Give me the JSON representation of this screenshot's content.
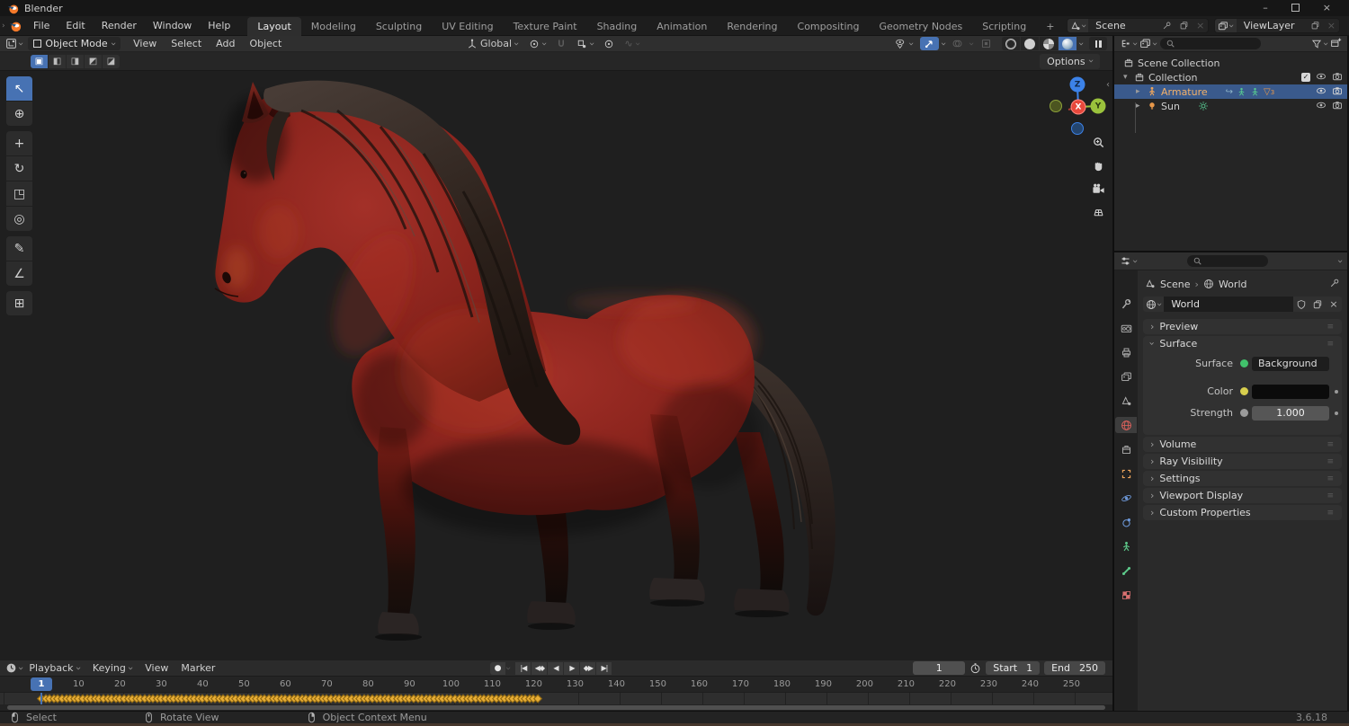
{
  "window": {
    "title": "Blender"
  },
  "topbar": {
    "menus": [
      "File",
      "Edit",
      "Render",
      "Window",
      "Help"
    ],
    "workspaces": [
      "Layout",
      "Modeling",
      "Sculpting",
      "UV Editing",
      "Texture Paint",
      "Shading",
      "Animation",
      "Rendering",
      "Compositing",
      "Geometry Nodes",
      "Scripting",
      "+"
    ],
    "active_workspace": "Layout",
    "scene": {
      "label": "Scene"
    },
    "viewlayer": {
      "label": "ViewLayer"
    }
  },
  "viewport": {
    "mode": "Object Mode",
    "menus": [
      "View",
      "Select",
      "Add",
      "Object"
    ],
    "orientation": "Global",
    "options_label": "Options",
    "tools": [
      {
        "name": "select-box",
        "glyph": "↖"
      },
      {
        "name": "cursor",
        "glyph": "⊕"
      },
      {
        "name": "move",
        "glyph": "+"
      },
      {
        "name": "rotate",
        "glyph": "↻"
      },
      {
        "name": "scale",
        "glyph": "◳"
      },
      {
        "name": "transform",
        "glyph": "◎"
      },
      {
        "name": "annotate",
        "glyph": "✎"
      },
      {
        "name": "measure",
        "glyph": "∠"
      },
      {
        "name": "add-cube",
        "glyph": "⊞"
      }
    ],
    "select_modes": [
      "▣",
      "◧",
      "◨",
      "◩",
      "◪"
    ],
    "gizmo_axes": {
      "x": "X",
      "y": "Y",
      "z": "Z"
    }
  },
  "outliner": {
    "rows": [
      {
        "label": "Scene Collection"
      },
      {
        "label": "Collection"
      },
      {
        "label": "Armature",
        "badge": "3"
      },
      {
        "label": "Sun"
      }
    ]
  },
  "properties": {
    "breadcrumb": {
      "scene": "Scene",
      "sep": "›",
      "world": "World"
    },
    "datablock_name": "World",
    "panels": {
      "preview": "Preview",
      "surface": {
        "title": "Surface",
        "surface_label": "Surface",
        "surface_value": "Background",
        "color_label": "Color",
        "strength_label": "Strength",
        "strength_value": "1.000"
      },
      "collapsed": [
        "Volume",
        "Ray Visibility",
        "Settings",
        "Viewport Display",
        "Custom Properties"
      ]
    },
    "tabs": [
      "tool",
      "render",
      "output",
      "view-layer",
      "scene",
      "world",
      "collection",
      "object",
      "physics",
      "constraints",
      "data",
      "bone",
      "texture"
    ],
    "active_tab": "world"
  },
  "timeline": {
    "menus": [
      {
        "label": "Playback",
        "chevron": true
      },
      {
        "label": "Keying",
        "chevron": true
      },
      {
        "label": "View",
        "chevron": false
      },
      {
        "label": "Marker",
        "chevron": false
      }
    ],
    "record_glyph": "●",
    "transport": [
      "|◀",
      "◀◆",
      "◀",
      "▶",
      "◆▶",
      "▶|"
    ],
    "current_frame": "1",
    "start_label": "Start",
    "start_value": "1",
    "end_label": "End",
    "end_value": "250",
    "ruler_ticks": [
      10,
      20,
      30,
      40,
      50,
      60,
      70,
      80,
      90,
      100,
      110,
      120,
      130,
      140,
      150,
      160,
      170,
      180,
      190,
      200,
      210,
      220,
      230,
      240,
      250
    ],
    "keyframes": {
      "from": 1,
      "to": 121
    }
  },
  "statusbar": {
    "items": [
      {
        "icon": "mouse-left",
        "label": "Select"
      },
      {
        "icon": "mouse-middle",
        "label": "Rotate View"
      },
      {
        "icon": "mouse-right",
        "label": "Object Context Menu"
      }
    ],
    "version": "3.6.18"
  },
  "icons": {
    "chevron": "›",
    "disclosure_closed": "▸",
    "disclosure_open": "▾",
    "panel_closed": "›",
    "close": "×",
    "minimize": "–",
    "dots": "≡"
  },
  "colors": {
    "accent_blue": "#4772b3",
    "keyframe_yellow": "#e7ad35",
    "active_object_orange": "#f2b06a",
    "axis_x": "#e8483c",
    "axis_y": "#9ac23c",
    "axis_z": "#3c82e8"
  }
}
